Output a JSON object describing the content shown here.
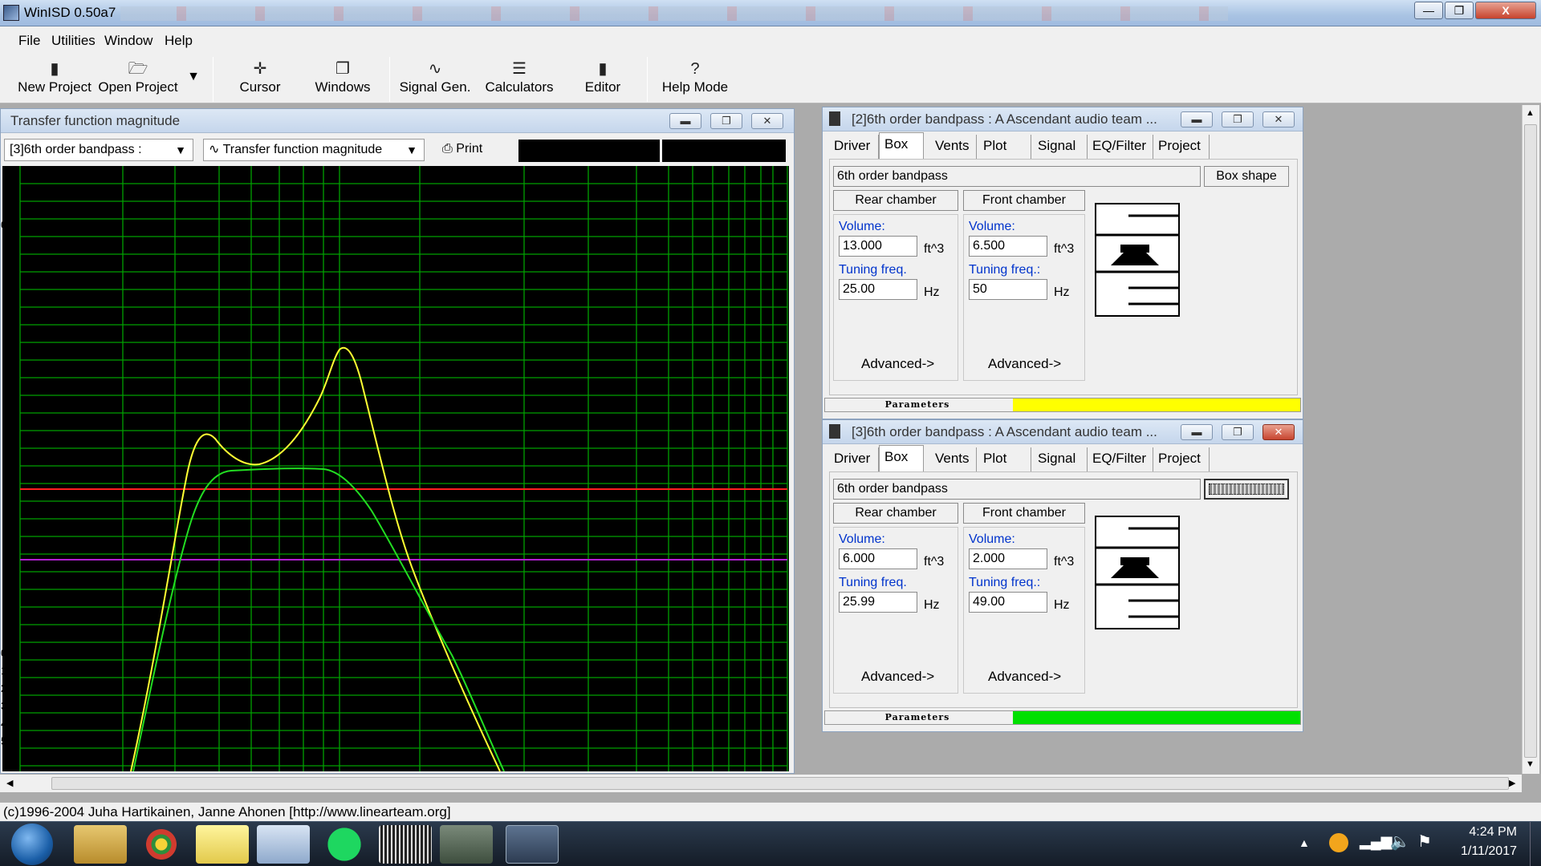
{
  "window": {
    "title": "WinISD 0.50a7",
    "min_label": "—",
    "max_label": "❐",
    "close_label": "X"
  },
  "menu": [
    "File",
    "Utilities",
    "Window",
    "Help"
  ],
  "toolbar": {
    "new_project": "New Project",
    "open_project": "Open Project",
    "cursor": "Cursor",
    "windows": "Windows",
    "signal_gen": "Signal Gen.",
    "calculators": "Calculators",
    "editor": "Editor",
    "help_mode": "Help Mode"
  },
  "graph_window": {
    "title": "Transfer function magnitude",
    "project_select": "[3]6th order bandpass :",
    "graph_select": "Transfer function magnitude",
    "print_label": "Print",
    "axis_labels": [
      "0",
      "0",
      "1",
      "2",
      "3",
      "4",
      "5"
    ],
    "colors": {
      "project2": "#ffff33",
      "project3": "#22dd22",
      "grid": "#00a000",
      "ref_red": "#ff2020",
      "ref_purple": "#b020d0"
    }
  },
  "box_window_2": {
    "title": "[2]6th order bandpass : A Ascendant audio team ...",
    "tabs": [
      "Driver",
      "Box",
      "Vents",
      "Plot",
      "Signal",
      "EQ/Filter",
      "Project"
    ],
    "box_type": "6th order bandpass",
    "box_shape_label": "Box shape",
    "rear": {
      "label": "Rear chamber",
      "volume_label": "Volume:",
      "volume": "13.000",
      "volume_unit": "ft^3",
      "tuning_label": "Tuning freq.",
      "tuning": "25.00",
      "tuning_unit": "Hz",
      "advanced": "Advanced->"
    },
    "front": {
      "label": "Front chamber",
      "volume_label": "Volume:",
      "volume": "6.500",
      "volume_unit": "ft^3",
      "tuning_label": "Tuning freq.:",
      "tuning": "50",
      "tuning_unit": "Hz",
      "advanced": "Advanced->"
    },
    "status_label": "Parameters",
    "status_color": "#ffff00"
  },
  "box_window_3": {
    "title": "[3]6th order bandpass : A Ascendant audio team ...",
    "tabs": [
      "Driver",
      "Box",
      "Vents",
      "Plot",
      "Signal",
      "EQ/Filter",
      "Project"
    ],
    "box_type": "6th order bandpass",
    "rear": {
      "label": "Rear chamber",
      "volume_label": "Volume:",
      "volume": "6.000",
      "volume_unit": "ft^3",
      "tuning_label": "Tuning freq.",
      "tuning": "25.99",
      "tuning_unit": "Hz",
      "advanced": "Advanced->"
    },
    "front": {
      "label": "Front chamber",
      "volume_label": "Volume:",
      "volume": "2.000",
      "volume_unit": "ft^3",
      "tuning_label": "Tuning freq.:",
      "tuning": "49.00",
      "tuning_unit": "Hz",
      "advanced": "Advanced->"
    },
    "status_label": "Parameters",
    "status_color": "#00e000"
  },
  "statusbar": "(c)1996-2004 Juha Hartikainen, Janne Ahonen [http://www.linearteam.org]",
  "clock": {
    "time": "4:24 PM",
    "date": "1/11/2017"
  }
}
